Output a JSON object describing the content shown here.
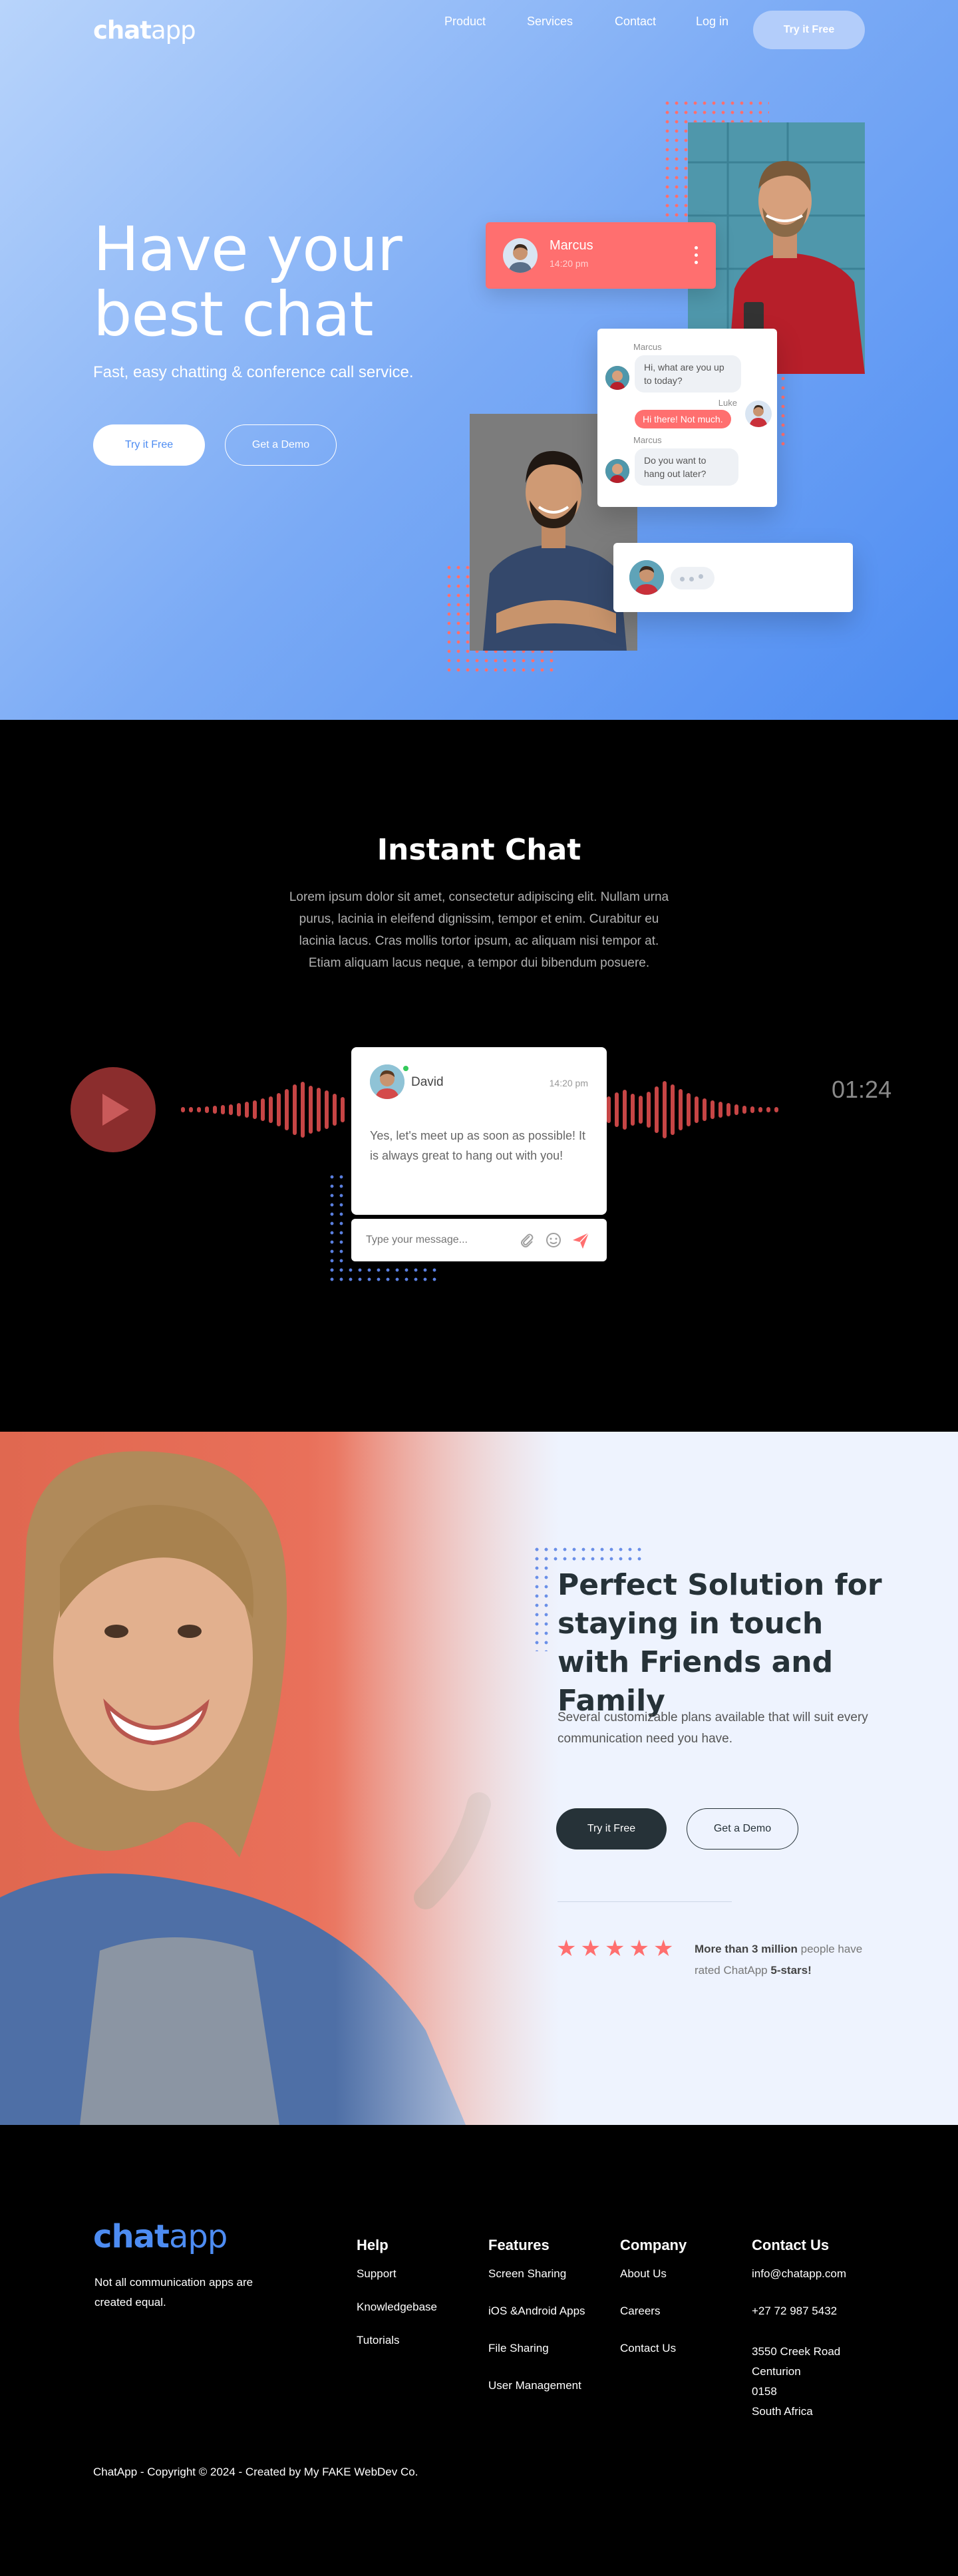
{
  "brand": {
    "bold": "chat",
    "light": "app"
  },
  "nav": {
    "items": [
      "Product",
      "Services",
      "Contact",
      "Log in"
    ],
    "cta": "Try it Free"
  },
  "hero": {
    "title": "Have your best chat",
    "subtitle": "Fast, easy chatting & conference call service.",
    "primary_button": "Try it Free",
    "secondary_button": "Get a Demo",
    "marcus_card": {
      "name": "Marcus",
      "time": "14:20 pm"
    },
    "conversation": [
      {
        "name": "Marcus",
        "text": "Hi, what are you up to today?"
      },
      {
        "name": "Luke",
        "text": "Hi there! Not much."
      },
      {
        "name": "Marcus",
        "text": "Do you want to hang out later?"
      }
    ],
    "accent": "#ff6f6f"
  },
  "instant": {
    "title": "Instant Chat",
    "paragraph": "Lorem ipsum dolor sit amet, consectetur adipiscing elit. Nullam urna purus, lacinia in eleifend dignissim, tempor et enim. Curabitur eu lacinia lacus. Cras mollis tortor ipsum, ac aliquam nisi tempor at. Etiam aliquam lacus neque, a tempor dui bibendum posuere.",
    "timer": "01:24",
    "message": {
      "name": "David",
      "time": "14:20 pm",
      "text": "Yes, let's meet up as soon as possible! It is always great to hang out with you!"
    },
    "input_placeholder": "Type your message..."
  },
  "perfect": {
    "title": "Perfect Solution for staying in touch with Friends and Family",
    "text": "Several customizable plans available that will suit every communication need you have.",
    "primary_button": "Try it Free",
    "secondary_button": "Get a Demo",
    "rating_prefix": "More than 3 million",
    "rating_mid": " people have rated ChatApp ",
    "rating_suffix": "5-stars!",
    "stars": 5
  },
  "footer": {
    "tagline": "Not all communication apps are created equal.",
    "columns": [
      {
        "title": "Help",
        "links": [
          "Support",
          "Knowledgebase",
          "Tutorials"
        ]
      },
      {
        "title": "Features",
        "links": [
          "Screen Sharing",
          "iOS &Android Apps",
          "File Sharing",
          "User Management"
        ]
      },
      {
        "title": "Company",
        "links": [
          "About Us",
          "Careers",
          "Contact Us"
        ]
      }
    ],
    "contact": {
      "title": "Contact Us",
      "email": "info@chatapp.com",
      "phone": "+27 72 987 5432",
      "address": [
        "3550 Creek Road",
        "Centurion",
        "0158",
        "South Africa"
      ]
    },
    "copyright": "ChatApp - Copyright © 2024 - Created by My FAKE WebDev Co."
  }
}
